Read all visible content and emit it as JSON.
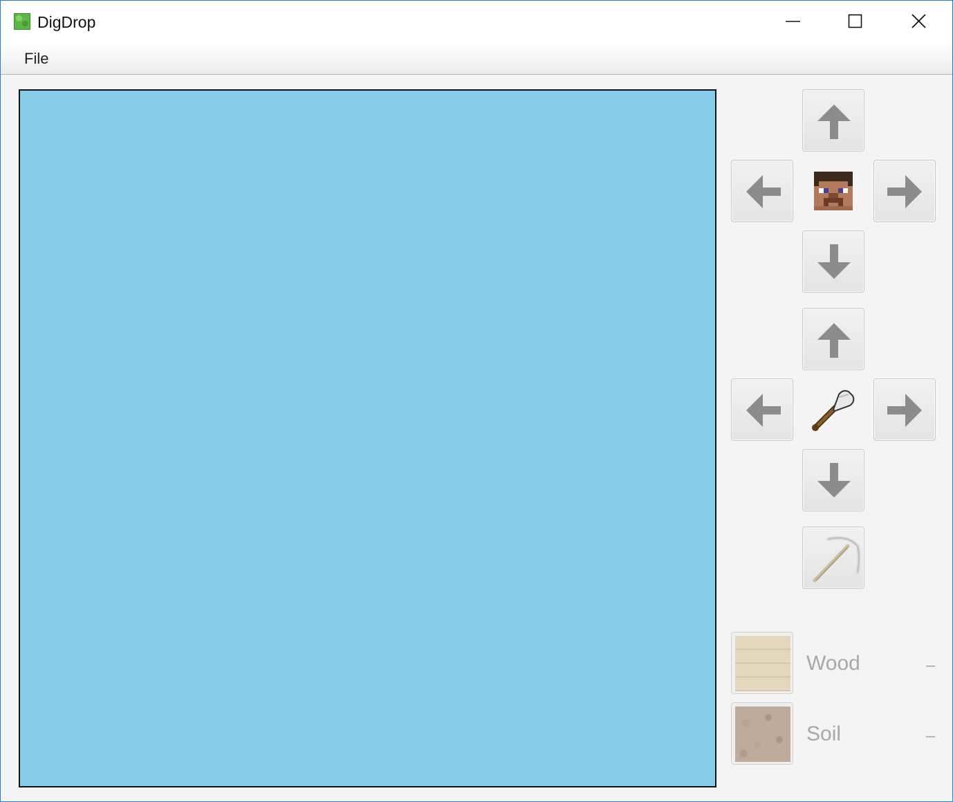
{
  "window": {
    "title": "DigDrop",
    "accent": "#2b7bd6"
  },
  "menu": {
    "file_label": "File"
  },
  "canvas": {
    "background": "#87cce9"
  },
  "player_controls": {
    "center_icon": "steve-head-icon",
    "buttons": [
      "move-up",
      "move-left",
      "move-right",
      "move-down"
    ]
  },
  "dig_controls": {
    "center_icon": "shovel-icon",
    "buttons": [
      "dig-up",
      "dig-left",
      "dig-right",
      "dig-down"
    ]
  },
  "tool_button": {
    "icon": "pickaxe-icon"
  },
  "inventory": {
    "items": [
      {
        "label": "Wood",
        "count": "–",
        "icon": "wood-planks-icon"
      },
      {
        "label": "Soil",
        "count": "–",
        "icon": "soil-block-icon"
      }
    ]
  }
}
